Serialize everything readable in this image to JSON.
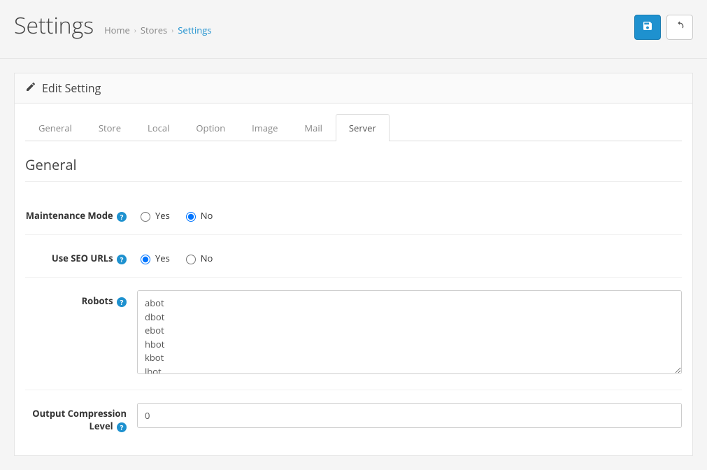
{
  "header": {
    "title": "Settings",
    "breadcrumbs": [
      {
        "label": "Home",
        "active": false
      },
      {
        "label": "Stores",
        "active": false
      },
      {
        "label": "Settings",
        "active": true
      }
    ]
  },
  "panel": {
    "heading": "Edit Setting"
  },
  "tabs": [
    {
      "label": "General",
      "active": false
    },
    {
      "label": "Store",
      "active": false
    },
    {
      "label": "Local",
      "active": false
    },
    {
      "label": "Option",
      "active": false
    },
    {
      "label": "Image",
      "active": false
    },
    {
      "label": "Mail",
      "active": false
    },
    {
      "label": "Server",
      "active": true
    }
  ],
  "section": {
    "title": "General"
  },
  "form": {
    "maintenance_mode": {
      "label": "Maintenance Mode",
      "yes": "Yes",
      "no": "No",
      "value": "no"
    },
    "seo_urls": {
      "label": "Use SEO URLs",
      "yes": "Yes",
      "no": "No",
      "value": "yes"
    },
    "robots": {
      "label": "Robots",
      "value": "abot\ndbot\nebot\nhbot\nkbot\nlbot"
    },
    "output_compression": {
      "label": "Output Compression Level",
      "value": "0"
    }
  }
}
